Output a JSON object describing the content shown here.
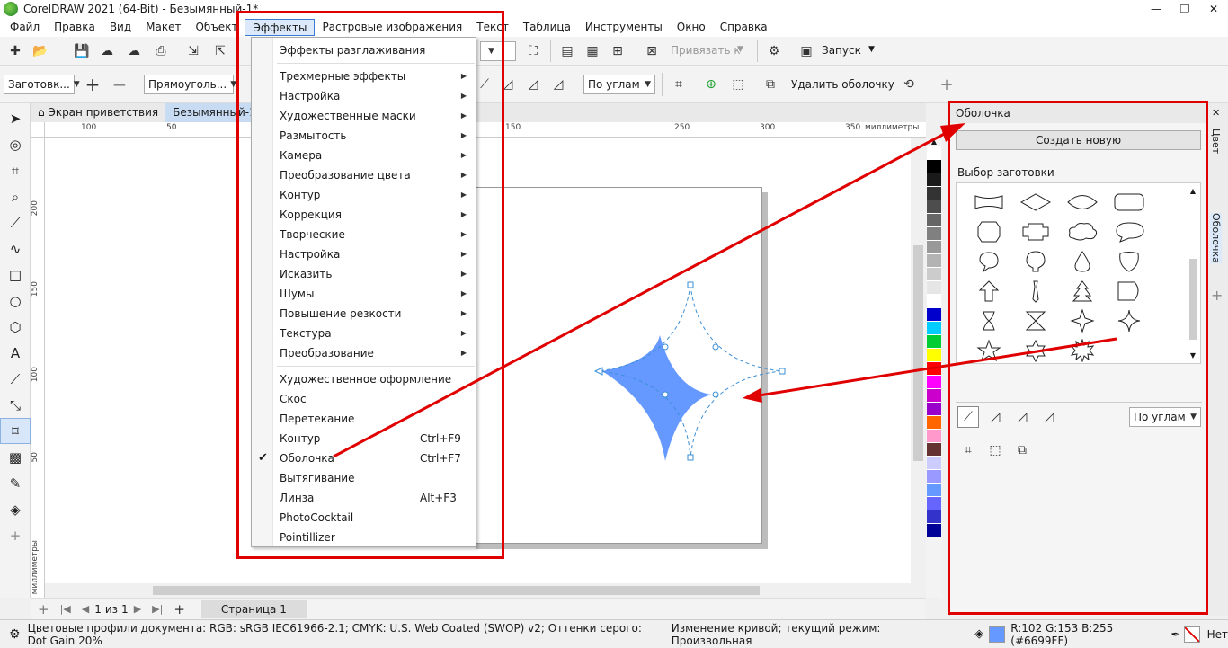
{
  "window": {
    "title": "CorelDRAW 2021 (64-Bit) - Безымянный-1*",
    "controls": [
      "—",
      "❐",
      "✕"
    ]
  },
  "menu": [
    "Файл",
    "Правка",
    "Вид",
    "Макет",
    "Объект",
    "Эффекты",
    "Растровые изображения",
    "Текст",
    "Таблица",
    "Инструменты",
    "Окно",
    "Справка"
  ],
  "toolbar1": {
    "snap_label": "Привязать к",
    "launch_label": "Запуск"
  },
  "toolbar2": {
    "preset_combo": "Заготовк...",
    "shape_combo": "Прямоуголь...",
    "mapping_combo": "По углам",
    "remove_envelope": "Удалить оболочку"
  },
  "doc_tabs": [
    "Экран приветствия",
    "Безымянный-1*"
  ],
  "ruler": {
    "h_labels": [
      "100",
      "50",
      "150",
      "250",
      "300",
      "350"
    ],
    "h_unit": "миллиметры",
    "v_labels": [
      "200",
      "150",
      "100",
      "50"
    ],
    "v_unit": "миллиметры"
  },
  "effects_menu": {
    "items": [
      {
        "label": "Эффекты разглаживания",
        "submenu": false
      },
      {
        "label": "Трехмерные эффекты",
        "submenu": true
      },
      {
        "label": "Настройка",
        "submenu": true
      },
      {
        "label": "Художественные маски",
        "submenu": true
      },
      {
        "label": "Размытость",
        "submenu": true
      },
      {
        "label": "Камера",
        "submenu": true
      },
      {
        "label": "Преобразование цвета",
        "submenu": true
      },
      {
        "label": "Контур",
        "submenu": true
      },
      {
        "label": "Коррекция",
        "submenu": true
      },
      {
        "label": "Творческие",
        "submenu": true
      },
      {
        "label": "Настройка",
        "submenu": true
      },
      {
        "label": "Исказить",
        "submenu": true
      },
      {
        "label": "Шумы",
        "submenu": true
      },
      {
        "label": "Повышение резкости",
        "submenu": true
      },
      {
        "label": "Текстура",
        "submenu": true
      },
      {
        "label": "Преобразование",
        "submenu": true
      },
      {
        "label": "Художественное оформление",
        "submenu": false
      },
      {
        "label": "Скос",
        "submenu": false
      },
      {
        "label": "Перетекание",
        "submenu": false
      },
      {
        "label": "Контур",
        "submenu": false,
        "shortcut": "Ctrl+F9"
      },
      {
        "label": "Оболочка",
        "submenu": false,
        "shortcut": "Ctrl+F7",
        "checked": true
      },
      {
        "label": "Вытягивание",
        "submenu": false
      },
      {
        "label": "Линза",
        "submenu": false,
        "shortcut": "Alt+F3"
      },
      {
        "label": "PhotoCocktail",
        "submenu": false
      },
      {
        "label": "Pointillizer",
        "submenu": false
      }
    ],
    "checkmark": "✔"
  },
  "docker": {
    "title": "Оболочка",
    "create_button": "Создать новую",
    "preset_label": "Выбор заготовки",
    "mapping": "По углам"
  },
  "side_tabs": [
    "Цвет",
    "Оболочка"
  ],
  "page_nav": {
    "position": "1",
    "of": "из",
    "total": "1",
    "page_tab": "Страница 1"
  },
  "status": {
    "profiles": "Цветовые профили документа: RGB: sRGB IEC61966-2.1; CMYK: U.S. Web Coated (SWOP) v2; Оттенки серого: Dot Gain 20%",
    "mode": "Изменение кривой; текущий режим: Произвольная",
    "fill_color": "R:102 G:153 B:255 (#6699FF)",
    "outline": "Нет"
  },
  "colors": {
    "shape_fill": "#6699ff",
    "highlight_red": "#e00000",
    "palette": [
      "#ffffff",
      "#000000",
      "#1a1a1a",
      "#333333",
      "#4d4d4d",
      "#666666",
      "#808080",
      "#999999",
      "#b3b3b3",
      "#cccccc",
      "#e6e6e6",
      "#ffffff",
      "#0000cc",
      "#00ccff",
      "#00cc33",
      "#ffff00",
      "#ff0000",
      "#ff00ff",
      "#cc00cc",
      "#9900cc",
      "#ff6600",
      "#ff99cc",
      "#663333",
      "#ccccff",
      "#9999ff",
      "#6699ff",
      "#6666ff",
      "#3333cc",
      "#000099"
    ]
  }
}
